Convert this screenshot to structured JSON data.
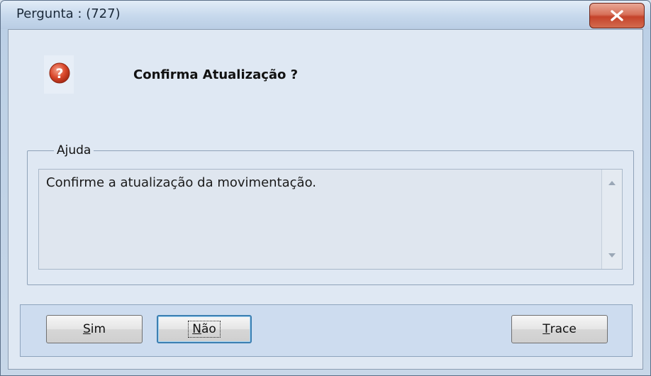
{
  "window": {
    "title": "Pergunta : (727)",
    "close_label": "x"
  },
  "question": {
    "icon": "question-icon",
    "text": "Confirma Atualização ?"
  },
  "help": {
    "legend": "Ajuda",
    "text": "Confirme a atualização da movimentação."
  },
  "buttons": {
    "sim": {
      "mnemonic": "S",
      "rest": "im"
    },
    "nao": {
      "mnemonic": "N",
      "rest": "ão"
    },
    "trace": {
      "mnemonic": "T",
      "rest": "race"
    }
  },
  "colors": {
    "icon_red": "#d9472b",
    "focus_blue": "#3c7fb1",
    "close_red": "#c5432a"
  }
}
